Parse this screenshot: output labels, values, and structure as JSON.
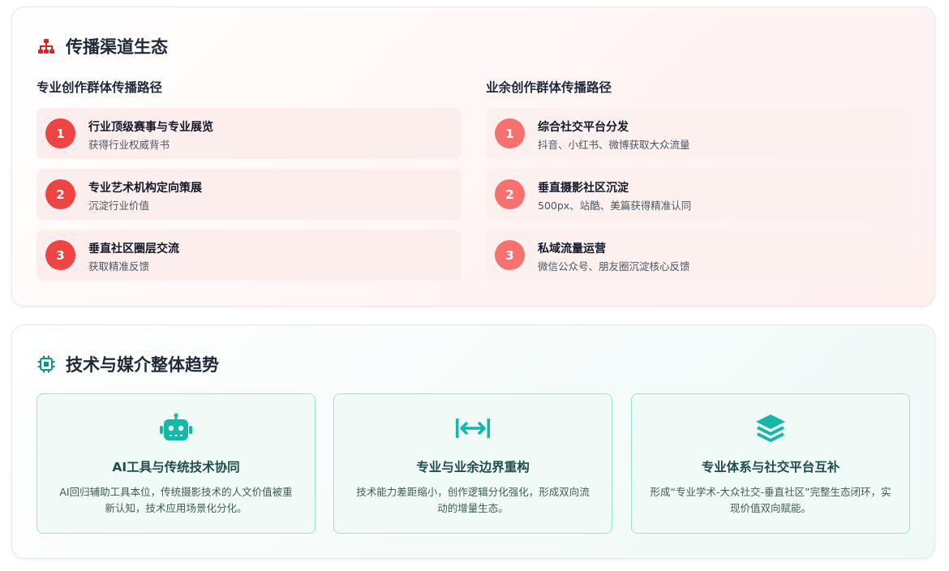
{
  "channels": {
    "title": "传播渠道生态",
    "icon": "sitemap-icon",
    "professional": {
      "title": "专业创作群体传播路径",
      "items": [
        {
          "num": "1",
          "title": "行业顶级赛事与专业展览",
          "sub": "获得行业权威背书"
        },
        {
          "num": "2",
          "title": "专业艺术机构定向策展",
          "sub": "沉淀行业价值"
        },
        {
          "num": "3",
          "title": "垂直社区圈层交流",
          "sub": "获取精准反馈"
        }
      ]
    },
    "amateur": {
      "title": "业余创作群体传播路径",
      "items": [
        {
          "num": "1",
          "title": "综合社交平台分发",
          "sub": "抖音、小红书、微博获取大众流量"
        },
        {
          "num": "2",
          "title": "垂直摄影社区沉淀",
          "sub": "500px、站酷、美篇获得精准认同"
        },
        {
          "num": "3",
          "title": "私域流量运营",
          "sub": "微信公众号、朋友圈沉淀核心反馈"
        }
      ]
    },
    "colors": {
      "primary": "#ef4444",
      "secondary": "#f87171"
    }
  },
  "trends": {
    "title": "技术与媒介整体趋势",
    "icon": "chip-icon",
    "items": [
      {
        "icon": "robot-icon",
        "title": "AI工具与传统技术协同",
        "desc": "AI回归辅助工具本位，传统摄影技术的人文价值被重新认知，技术应用场景化分化。"
      },
      {
        "icon": "arrows-left-right-icon",
        "title": "专业与业余边界重构",
        "desc": "技术能力差距缩小，创作逻辑分化强化，形成双向流动的增量生态。"
      },
      {
        "icon": "layers-icon",
        "title": "专业体系与社交平台互补",
        "desc": "形成“专业学术-大众社交-垂直社区”完整生态闭环，实现价值双向赋能。"
      }
    ],
    "colors": {
      "accent": "#14b8a6",
      "border": "#99e6d2"
    }
  }
}
